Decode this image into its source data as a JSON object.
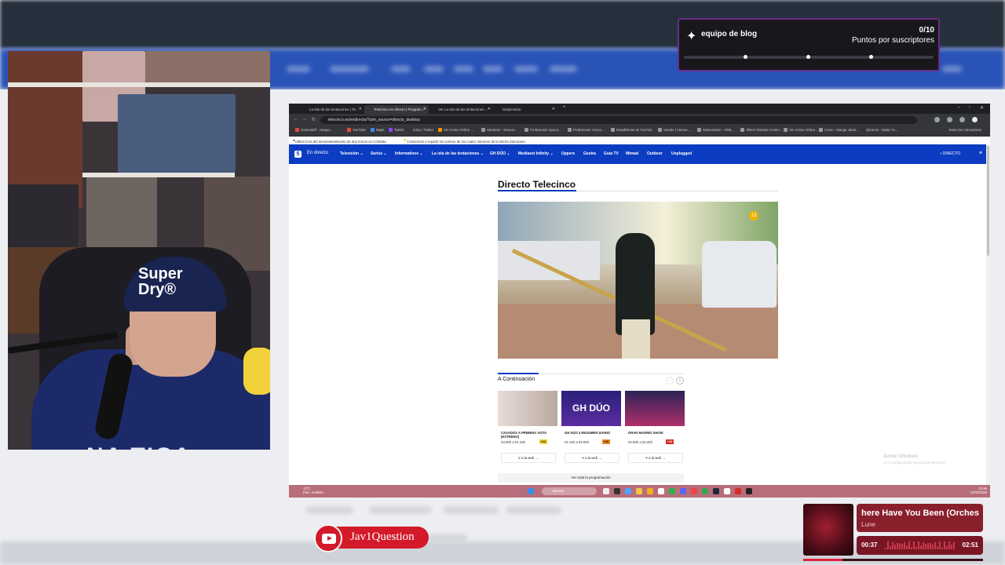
{
  "goal_widget": {
    "title": "equipo de blog",
    "count": "0/10",
    "subtitle": "Puntos por suscriptores",
    "progress": 0
  },
  "browser": {
    "tabs": [
      {
        "label": "La isla de las tentaciones | Te...",
        "active": false
      },
      {
        "label": "Telecinco en directo | Program...",
        "active": true
      },
      {
        "label": "Ver La isla de las tentaciones ...",
        "active": false
      },
      {
        "label": "Dailymotion",
        "active": false
      }
    ],
    "url": "telecinco.es/endirecto/?utm_source=directo_desktop",
    "bookmarks": [
      "Gamestuff - Juegos...",
      "YouTube",
      "Maps",
      "Twitch",
      "Inicio / Twitter",
      "Ver Anime Online ...",
      "Streamer - Descar...",
      "Profesional: Apoca...",
      "Profesional: Asoca...",
      "Estadísticas de YouTub...",
      "Vender | Atenea ...",
      "Subscription - OWL...",
      "Jikken Random Anime...",
      "Ver Anime Online -...",
      "Curso - Manga Janai...",
      "QiiVerse - Made Yo..."
    ],
    "all_bookmarks_label": "Todos los marcadores",
    "ticker": [
      "Ultima hora del desmantelamiento de dos tronos en Córdoba",
      "Comienzan a repartir los sorteos de los cuatro números de la lotería Zamorana"
    ]
  },
  "site": {
    "logo": "5",
    "live_label": "En directo",
    "menu": [
      "Televisión ⌄",
      "Series ⌄",
      "Informativos ⌄",
      "La isla de las tentaciones ⌄",
      "GH DÚO ⌄",
      "Mediaset Infinity ⌄",
      "Uppers",
      "Gestra",
      "Guía TV",
      "Mtmad",
      "Outdoor",
      "Unplugged"
    ],
    "directo_label": "• DIRECTO",
    "page_title": "Directo Telecinco",
    "player_badge": "12",
    "continuation_title": "A Continuación",
    "cards": [
      {
        "title": "CASADOS A PRIMERA VISTA (ESTRENO)",
        "time": "23:00h a 01:15h",
        "age": "+12",
        "age_color": "#f1d23a",
        "button": "Ir a la web →",
        "thumb_color": "#d8cfc8"
      },
      {
        "title": "GH DÚO 4 RESUMEN DIARIO",
        "time": "01:15h a 02:00h",
        "age": "+16",
        "age_color": "#f08a24",
        "button": "Ir a la web →",
        "thumb_color": "#3a2c8a",
        "thumb_text": "GH DÚO"
      },
      {
        "title": "GRAN MADRID SHOW",
        "time": "02:00h a 02:25h",
        "age": "+18",
        "age_color": "#d9241f",
        "button": "Ir a la web →",
        "thumb_color": "#2b2256"
      }
    ],
    "schedule_link": "Ver toda la programación",
    "watermark_title": "Activar Windows",
    "watermark_sub": "Ve a Configuración para activar Windows."
  },
  "taskbar": {
    "weather_temp": "13°C",
    "weather_desc": "Parc. nublado",
    "search_placeholder": "Buscar",
    "time": "23:46",
    "date": "13/02/2026"
  },
  "channel": {
    "name": "Jav1Question"
  },
  "music": {
    "song": "There Have You Been (Orchestral)",
    "song_visible": "here Have You Been (Orches",
    "artist": "Lune",
    "current": "00:37",
    "duration": "02:51",
    "progress": 0.22
  },
  "colors": {
    "telecinco_blue": "#0b3cc1",
    "goal_border": "#6b2c86",
    "youtube_red": "#d3192a",
    "music_red": "#8a1f2c"
  }
}
